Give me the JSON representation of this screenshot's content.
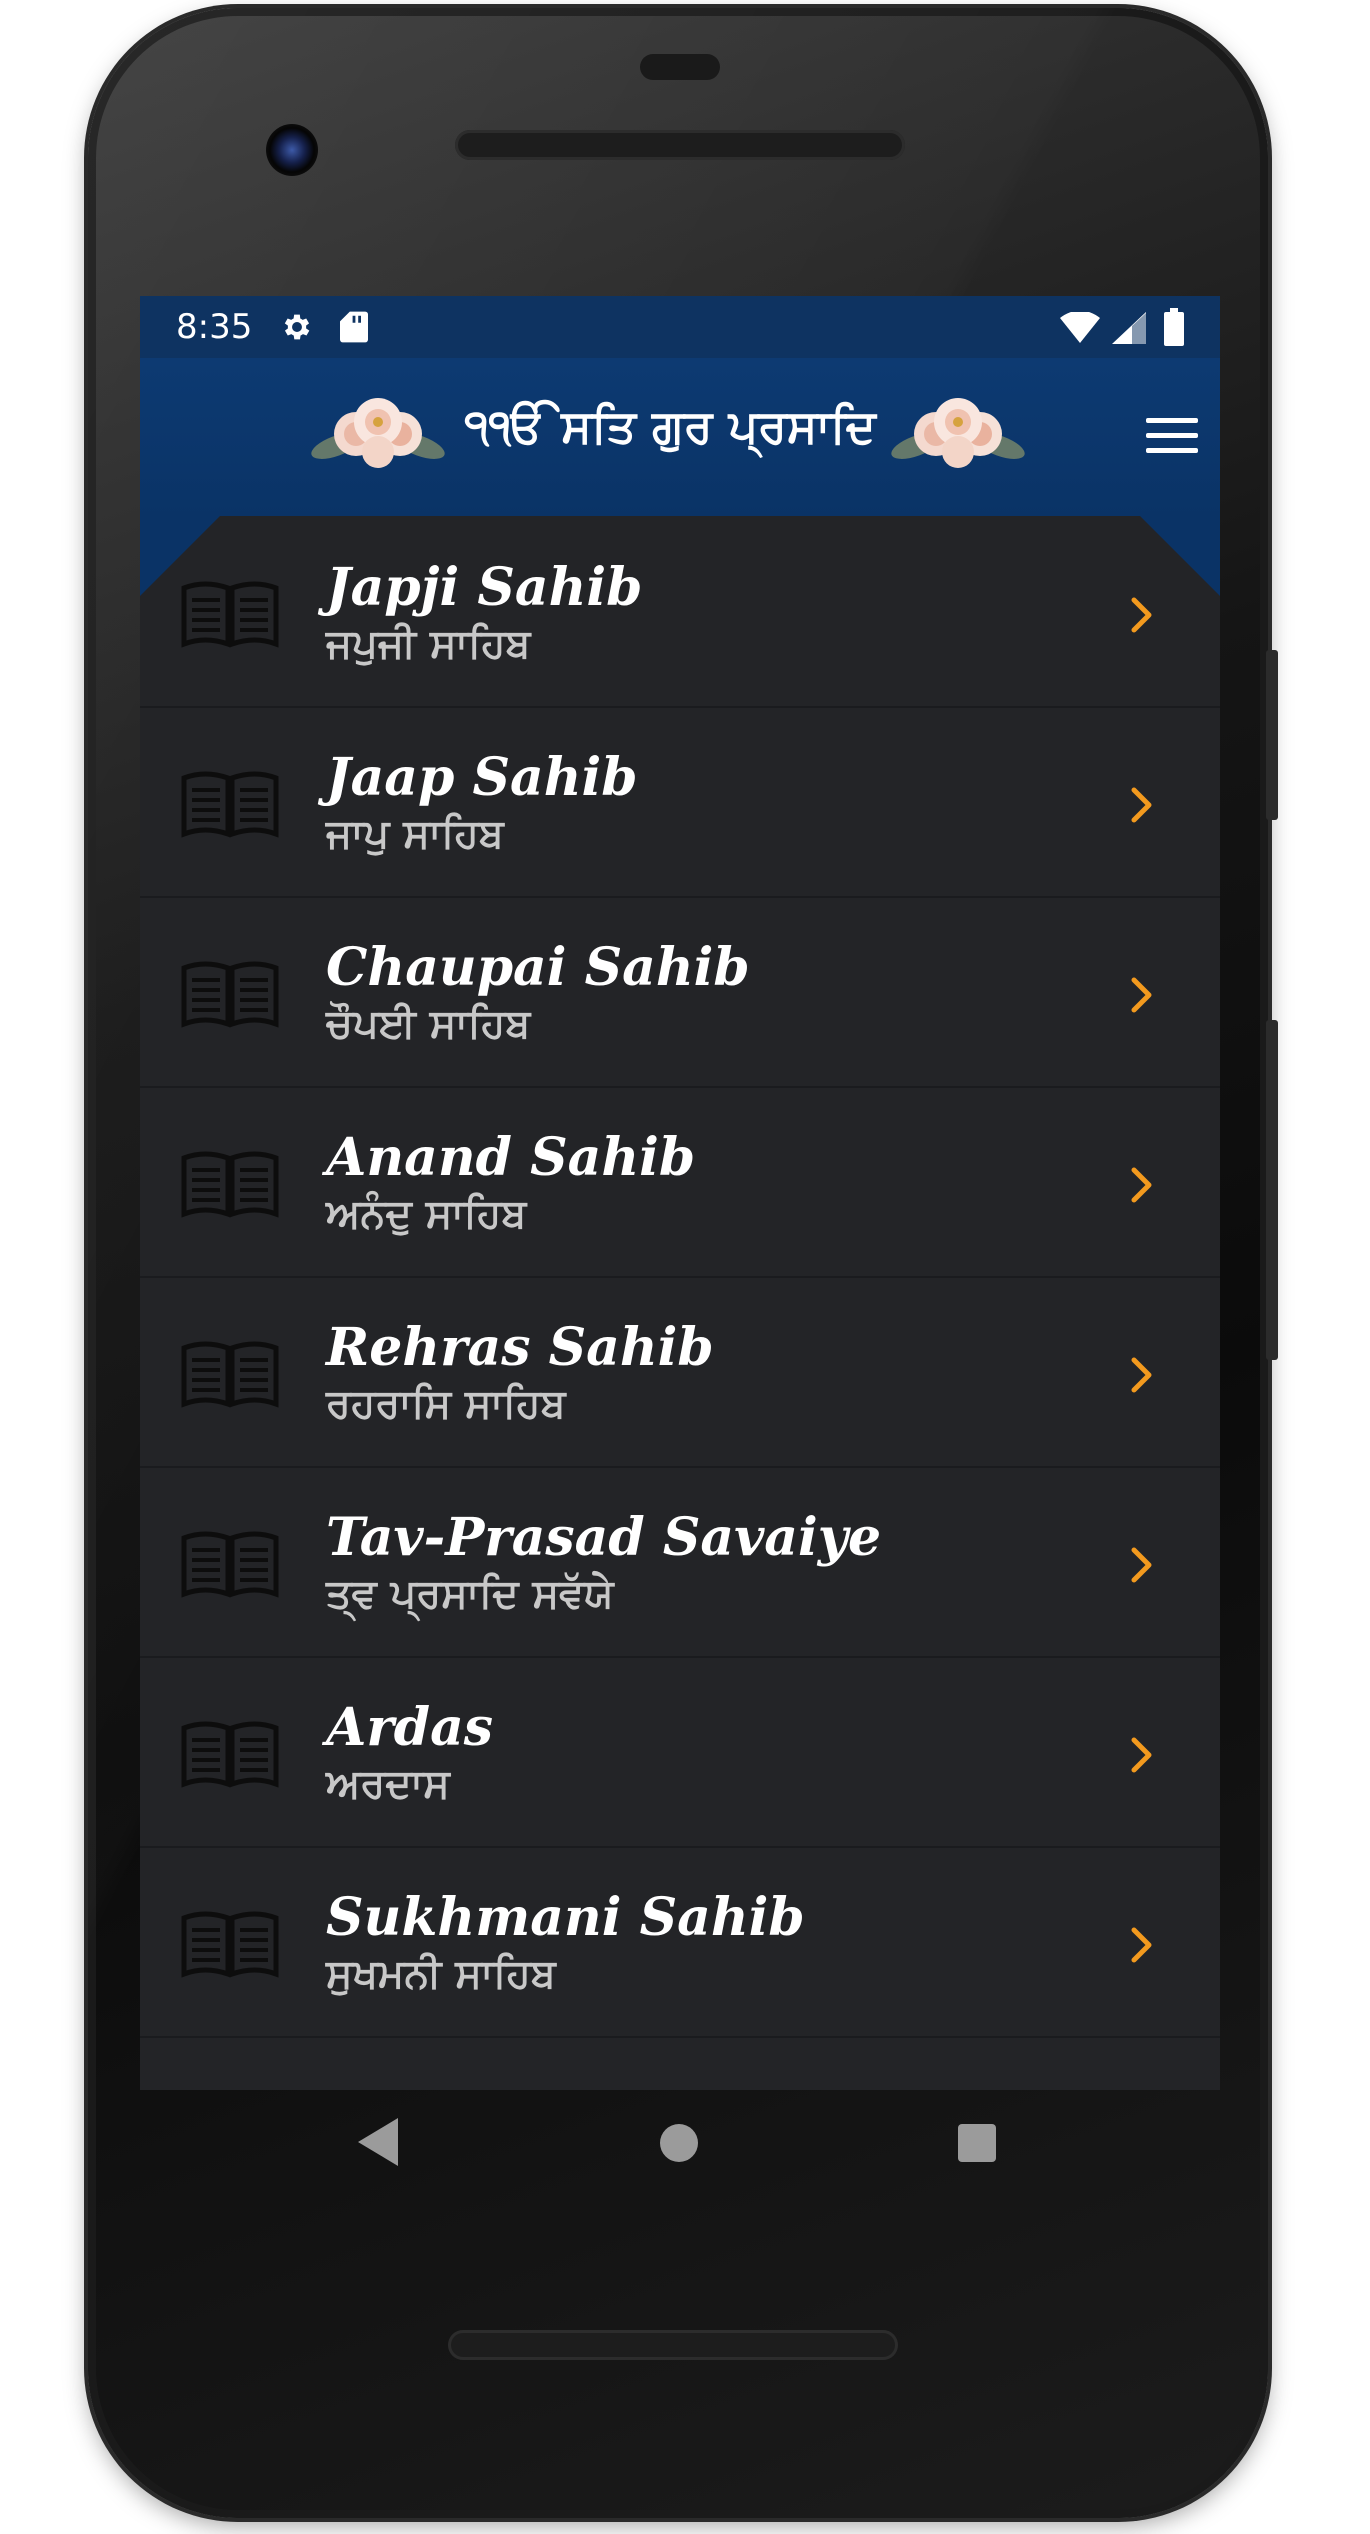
{
  "status_bar": {
    "time": "8:35",
    "icons": [
      "gear-icon",
      "sd-card-icon",
      "wifi-icon",
      "signal-icon",
      "battery-icon"
    ]
  },
  "header": {
    "title": "੧ੴ ਸਤਿ ਗੁਰ ਪ੍ਰਸਾਦਿ",
    "menu_icon": "hamburger-menu-icon",
    "decoration_icon": "flower-bouquet-icon",
    "background_color": "#0d3a72"
  },
  "banis": [
    {
      "title": "Japji Sahib",
      "subtitle": "ਜਪੁਜੀ ਸਾਹਿਬ"
    },
    {
      "title": "Jaap Sahib",
      "subtitle": "ਜਾਪੁ ਸਾਹਿਬ"
    },
    {
      "title": "Chaupai Sahib",
      "subtitle": "ਚੌਪਈ ਸਾਹਿਬ"
    },
    {
      "title": "Anand Sahib",
      "subtitle": "ਅਨੰਦੁ ਸਾਹਿਬ"
    },
    {
      "title": "Rehras Sahib",
      "subtitle": "ਰਹਰਾਸਿ ਸਾਹਿਬ"
    },
    {
      "title": "Tav-Prasad Savaiye",
      "subtitle": "ਤ੍ਵ ਪ੍ਰਸਾਦਿ ਸਵੱਯੇ"
    },
    {
      "title": "Ardas",
      "subtitle": "ਅਰਦਾਸ"
    },
    {
      "title": "Sukhmani Sahib",
      "subtitle": "ਸੁਖਮਨੀ ਸਾਹਿਬ"
    }
  ],
  "list_item_icon": "book-icon",
  "chevron_icon": "chevron-right-icon",
  "colors": {
    "accent": "#f39a1e",
    "list_background": "#232427",
    "status_bar": "#0e3361"
  },
  "nav_bar": {
    "icons": [
      "back-icon",
      "home-icon",
      "recents-icon"
    ]
  }
}
